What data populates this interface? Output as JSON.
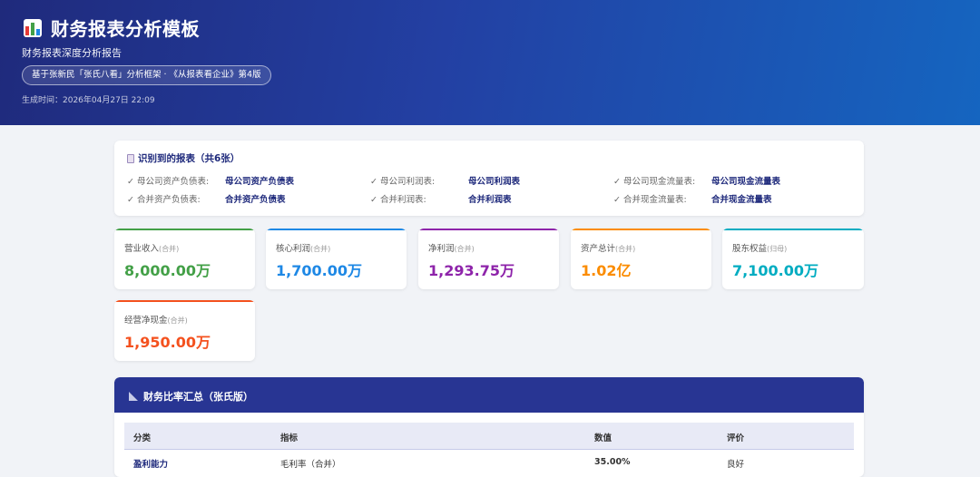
{
  "header": {
    "title": "财务报表分析模板",
    "subtitle": "财务报表深度分析报告",
    "framework": "基于张新民「张氏八看」分析框架 · 《从报表看企业》第4版",
    "generated": "生成时间：2026年04月27日 22:09",
    "icon": "bar-chart-icon"
  },
  "reports": {
    "title": "识别到的报表（共6张）",
    "icon": "document-icon",
    "check": "✓",
    "items": [
      {
        "label": "母公司资产负债表:",
        "value": "母公司资产负债表"
      },
      {
        "label": "母公司利润表:",
        "value": "母公司利润表"
      },
      {
        "label": "母公司现金流量表:",
        "value": "母公司现金流量表"
      },
      {
        "label": "合并资产负债表:",
        "value": "合并资产负债表"
      },
      {
        "label": "合并利润表:",
        "value": "合并利润表"
      },
      {
        "label": "合并现金流量表:",
        "value": "合并现金流量表"
      }
    ]
  },
  "metrics": [
    {
      "label": "营业收入",
      "tag": "(合并)",
      "value": "8,000.00万",
      "color": "#43a047"
    },
    {
      "label": "核心利润",
      "tag": "(合并)",
      "value": "1,700.00万",
      "color": "#1e88e5"
    },
    {
      "label": "净利润",
      "tag": "(合并)",
      "value": "1,293.75万",
      "color": "#8e24aa"
    },
    {
      "label": "资产总计",
      "tag": "(合并)",
      "value": "1.02亿",
      "color": "#fb8c00"
    },
    {
      "label": "股东权益",
      "tag": "(归母)",
      "value": "7,100.00万",
      "color": "#00acc1"
    },
    {
      "label": "经营净现金",
      "tag": "(合并)",
      "value": "1,950.00万",
      "color": "#f4511e"
    }
  ],
  "ratios": {
    "title": "财务比率汇总（张氏版）",
    "icon": "ruler-triangle-icon",
    "columns": [
      "分类",
      "指标",
      "数值",
      "评价"
    ],
    "rows": [
      [
        "盈利能力",
        "毛利率（合并）",
        "35.00%",
        "良好"
      ]
    ]
  }
}
